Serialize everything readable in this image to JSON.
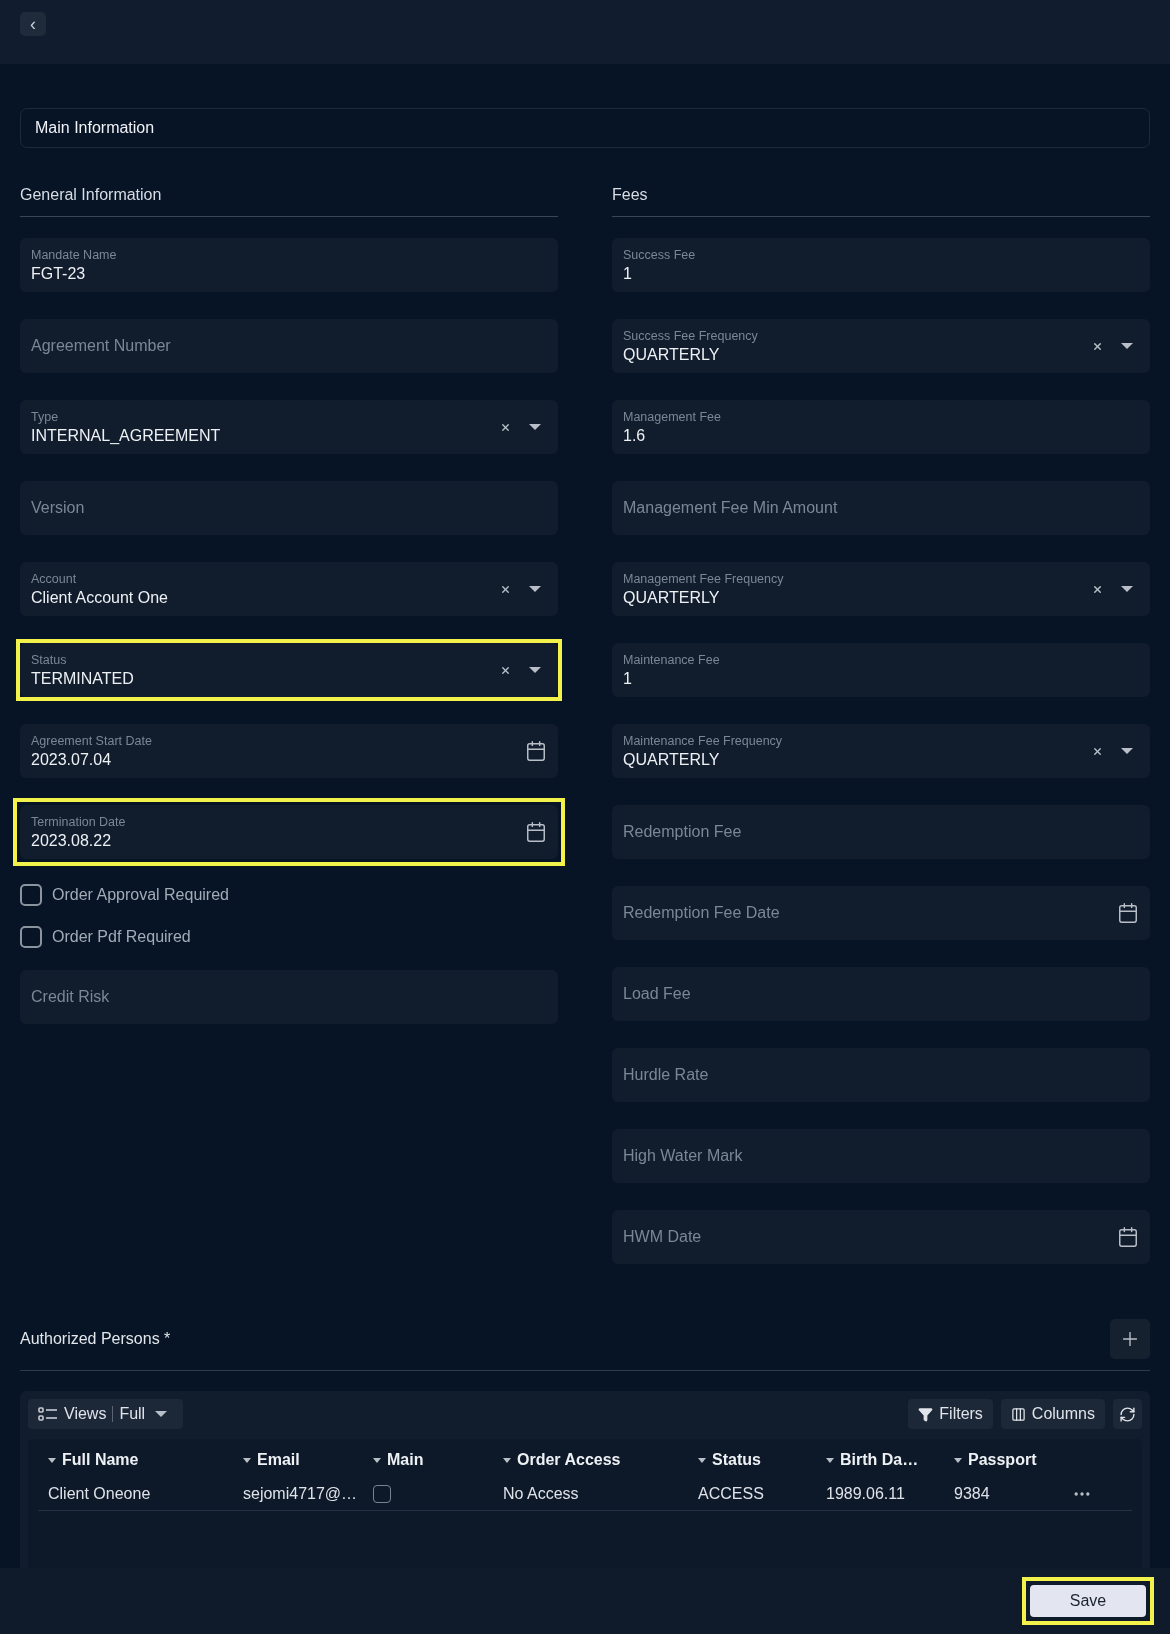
{
  "header": {
    "back": "‹"
  },
  "section_tab": "Main Information",
  "left": {
    "title": "General Information",
    "fields": [
      {
        "kind": "text",
        "label": "Mandate Name",
        "value": "FGT-23",
        "highlighted": false
      },
      {
        "kind": "text",
        "placeholder": "Agreement Number",
        "highlighted": false
      },
      {
        "kind": "select",
        "label": "Type",
        "value": "INTERNAL_AGREEMENT",
        "highlighted": false
      },
      {
        "kind": "text",
        "placeholder": "Version",
        "highlighted": false
      },
      {
        "kind": "select",
        "label": "Account",
        "value": "Client Account One",
        "highlighted": false
      },
      {
        "kind": "select",
        "label": "Status",
        "value": "TERMINATED",
        "highlighted": true
      },
      {
        "kind": "date",
        "label": "Agreement Start Date",
        "value": "2023.07.04",
        "highlighted": false
      },
      {
        "kind": "date",
        "label": "Termination Date",
        "value": "2023.08.22",
        "highlighted": true
      },
      {
        "kind": "checkbox",
        "label": "Order Approval Required",
        "checked": false
      },
      {
        "kind": "checkbox",
        "label": "Order Pdf Required",
        "checked": false
      },
      {
        "kind": "text",
        "placeholder": "Credit Risk",
        "highlighted": false
      }
    ]
  },
  "right": {
    "title": "Fees",
    "fields": [
      {
        "kind": "text",
        "label": "Success Fee",
        "value": "1",
        "highlighted": false
      },
      {
        "kind": "select",
        "label": "Success Fee Frequency",
        "value": "QUARTERLY",
        "highlighted": false
      },
      {
        "kind": "text",
        "label": "Management Fee",
        "value": "1.6",
        "highlighted": false
      },
      {
        "kind": "text",
        "placeholder": "Management Fee Min Amount",
        "highlighted": false
      },
      {
        "kind": "select",
        "label": "Management Fee Frequency",
        "value": "QUARTERLY",
        "highlighted": false
      },
      {
        "kind": "text",
        "label": "Maintenance Fee",
        "value": "1",
        "highlighted": false
      },
      {
        "kind": "select",
        "label": "Maintenance Fee Frequency",
        "value": "QUARTERLY",
        "highlighted": false
      },
      {
        "kind": "text",
        "placeholder": "Redemption Fee",
        "highlighted": false
      },
      {
        "kind": "date",
        "placeholder": "Redemption Fee Date",
        "highlighted": false
      },
      {
        "kind": "text",
        "placeholder": "Load Fee",
        "highlighted": false
      },
      {
        "kind": "text",
        "placeholder": "Hurdle Rate",
        "highlighted": false
      },
      {
        "kind": "text",
        "placeholder": "High Water Mark",
        "highlighted": false
      },
      {
        "kind": "date",
        "placeholder": "HWM Date",
        "highlighted": false
      }
    ]
  },
  "persons": {
    "title": "Authorized Persons *",
    "toolbar": {
      "views": "Views",
      "view_value": "Full",
      "filters": "Filters",
      "columns": "Columns"
    },
    "table": {
      "columns": [
        "Full Name",
        "Email",
        "Main",
        "Order Access",
        "Status",
        "Birth Da…",
        "Passport"
      ],
      "rows": [
        {
          "full_name": "Client Oneone",
          "email": "sejomi4717@…",
          "main": false,
          "order_access": "No Access",
          "status": "ACCESS",
          "birth_date": "1989.06.11",
          "passport": "9384"
        }
      ]
    }
  },
  "footer": {
    "save": "Save",
    "save_highlighted": true
  }
}
